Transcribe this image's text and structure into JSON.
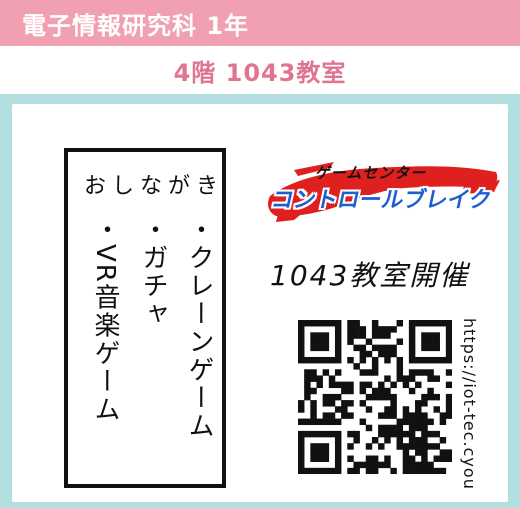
{
  "colors": {
    "header_bg": "#f0a0b0",
    "location_text": "#e07592",
    "panel_bg": "#b4dfe1",
    "logo_red": "#e0201f",
    "logo_blue": "#1e5fd0"
  },
  "header": {
    "title": "電子情報研究科 1年"
  },
  "location": {
    "text": "4階 1043教室"
  },
  "menu": {
    "title": "おしながき",
    "items": [
      "・クレーンゲーム",
      "・ガチャ",
      "・VR音楽ゲーム"
    ]
  },
  "logo": {
    "top": "ゲームセンター",
    "main": "コントロールブレイク"
  },
  "venue": "1043教室開催",
  "qr": {
    "url": "https://iot-tec.cyou",
    "icon": "qr-code-icon"
  }
}
